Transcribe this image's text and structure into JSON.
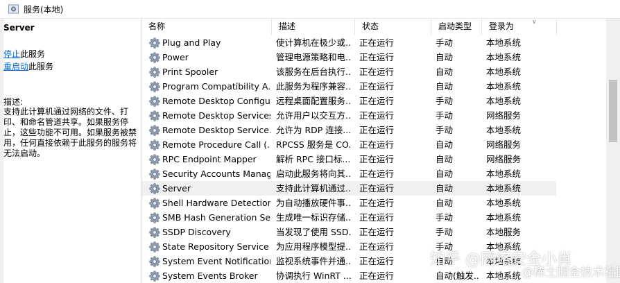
{
  "window": {
    "title": "服务(本地)"
  },
  "left_pane": {
    "service_name": "Server",
    "stop_link": "停止",
    "stop_suffix": "此服务",
    "restart_link": "重启动",
    "restart_suffix": "此服务",
    "description_label": "描述:",
    "description": "支持此计算机通过网络的文件、打印、和命名管道共享。如果服务停止，这些功能不可用。如果服务被禁用，任何直接依赖于此服务的服务将无法启动。"
  },
  "table": {
    "columns": [
      "名称",
      "描述",
      "状态",
      "启动类型",
      "登录为"
    ],
    "rows": [
      {
        "name": "Plug and Play",
        "desc": "使计算机在极少或...",
        "status": "正在运行",
        "startup": "手动",
        "logon": "本地系统"
      },
      {
        "name": "Power",
        "desc": "管理电源策略和电...",
        "status": "正在运行",
        "startup": "自动",
        "logon": "本地系统"
      },
      {
        "name": "Print Spooler",
        "desc": "该服务在后台执行...",
        "status": "正在运行",
        "startup": "自动",
        "logon": "本地系统"
      },
      {
        "name": "Program Compatibility A...",
        "desc": "此服务为程序兼容...",
        "status": "正在运行",
        "startup": "自动",
        "logon": "本地系统"
      },
      {
        "name": "Remote Desktop Configu...",
        "desc": "远程桌面配置服务...",
        "status": "正在运行",
        "startup": "手动",
        "logon": "本地系统"
      },
      {
        "name": "Remote Desktop Services",
        "desc": "允许用户以交互方...",
        "status": "正在运行",
        "startup": "手动",
        "logon": "网络服务"
      },
      {
        "name": "Remote Desktop Service...",
        "desc": "允许为 RDP 连接...",
        "status": "正在运行",
        "startup": "手动",
        "logon": "本地系统"
      },
      {
        "name": "Remote Procedure Call (...",
        "desc": "RPCSS 服务是 CO...",
        "status": "正在运行",
        "startup": "自动",
        "logon": "网络服务"
      },
      {
        "name": "RPC Endpoint Mapper",
        "desc": "解析 RPC 接口标...",
        "status": "正在运行",
        "startup": "自动",
        "logon": "网络服务"
      },
      {
        "name": "Security Accounts Manag...",
        "desc": "启动此服务将向其...",
        "status": "正在运行",
        "startup": "自动",
        "logon": "本地系统"
      },
      {
        "name": "Server",
        "desc": "支持此计算机通过...",
        "status": "正在运行",
        "startup": "自动",
        "logon": "本地系统"
      },
      {
        "name": "Shell Hardware Detection",
        "desc": "为自动播放硬件事...",
        "status": "正在运行",
        "startup": "自动",
        "logon": "本地系统"
      },
      {
        "name": "SMB Hash Generation Se...",
        "desc": "生成唯一标识存储...",
        "status": "正在运行",
        "startup": "手动",
        "logon": "本地系统"
      },
      {
        "name": "SSDP Discovery",
        "desc": "当发现了使用 SSD...",
        "status": "正在运行",
        "startup": "手动",
        "logon": "本地服务"
      },
      {
        "name": "State Repository Service",
        "desc": "为应用程序模型提...",
        "status": "正在运行",
        "startup": "手动",
        "logon": "本地系统"
      },
      {
        "name": "System Event Notification...",
        "desc": "监视系统事件并通...",
        "status": "正在运行",
        "startup": "自动",
        "logon": "本地系统"
      },
      {
        "name": "System Events Broker",
        "desc": "协调执行 WinRT ...",
        "status": "正在运行",
        "startup": "自动(触发...",
        "logon": "本地系统"
      }
    ],
    "selected_row": 10
  },
  "watermark": {
    "line1": "知乎 @网络安全小肖",
    "line2": "@稀土掘金技术社区"
  }
}
